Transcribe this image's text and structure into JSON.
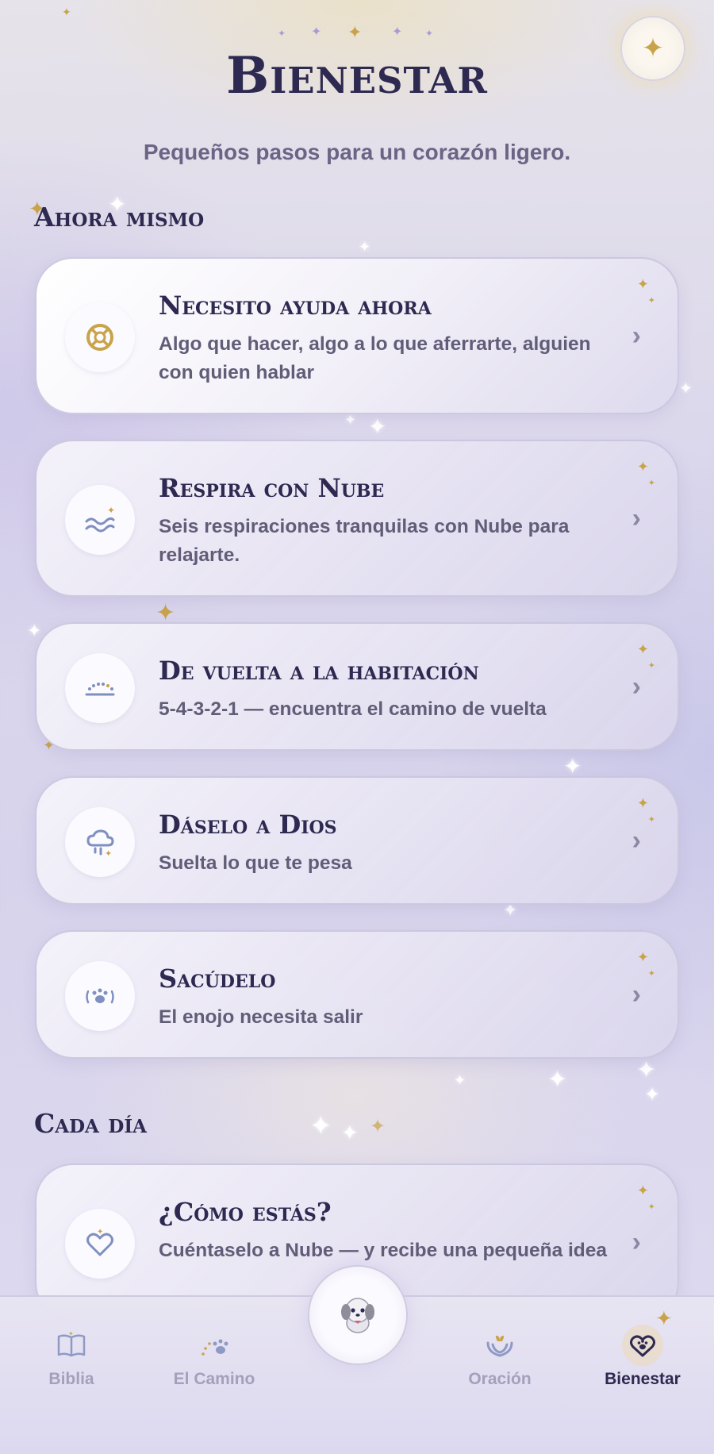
{
  "header": {
    "title": "Bienestar",
    "subtitle": "Pequeños pasos para un corazón ligero."
  },
  "sections": [
    {
      "title": "Ahora mismo",
      "cards": [
        {
          "title": "Necesito ayuda ahora",
          "description": "Algo que hacer, algo a lo que aferrarte, alguien con quien hablar",
          "icon": "lifebuoy-icon"
        },
        {
          "title": "Respira con Nube",
          "description": "Seis respiraciones tranquilas con Nube para relajarte.",
          "icon": "waves-icon"
        },
        {
          "title": "De vuelta a la habitación",
          "description": "5-4-3-2-1 — encuentra el camino de vuelta",
          "icon": "horizon-icon"
        },
        {
          "title": "Dáselo a Dios",
          "description": "Suelta lo que te pesa",
          "icon": "cloud-rain-icon"
        },
        {
          "title": "Sacúdelo",
          "description": "El enojo necesita salir",
          "icon": "paw-shake-icon"
        }
      ]
    },
    {
      "title": "Cada día",
      "cards": [
        {
          "title": "¿Cómo estás?",
          "description": "Cuéntaselo a Nube — y recibe una pequeña idea",
          "icon": "heart-icon"
        }
      ]
    }
  ],
  "tabbar": {
    "tabs": [
      {
        "label": "Biblia",
        "icon": "book-icon",
        "active": false
      },
      {
        "label": "El Camino",
        "icon": "paw-path-icon",
        "active": false
      },
      {
        "label": "Oración",
        "icon": "praying-hands-icon",
        "active": false
      },
      {
        "label": "Bienestar",
        "icon": "heart-paw-icon",
        "active": true
      }
    ],
    "center": {
      "icon": "nube-avatar-icon"
    }
  },
  "colors": {
    "primary_text": "#2d2950",
    "muted_text": "#615d78",
    "accent_gold": "#c9a34a",
    "icon_blue": "#7f8fbf",
    "inactive_tab": "#a3a0bb"
  }
}
